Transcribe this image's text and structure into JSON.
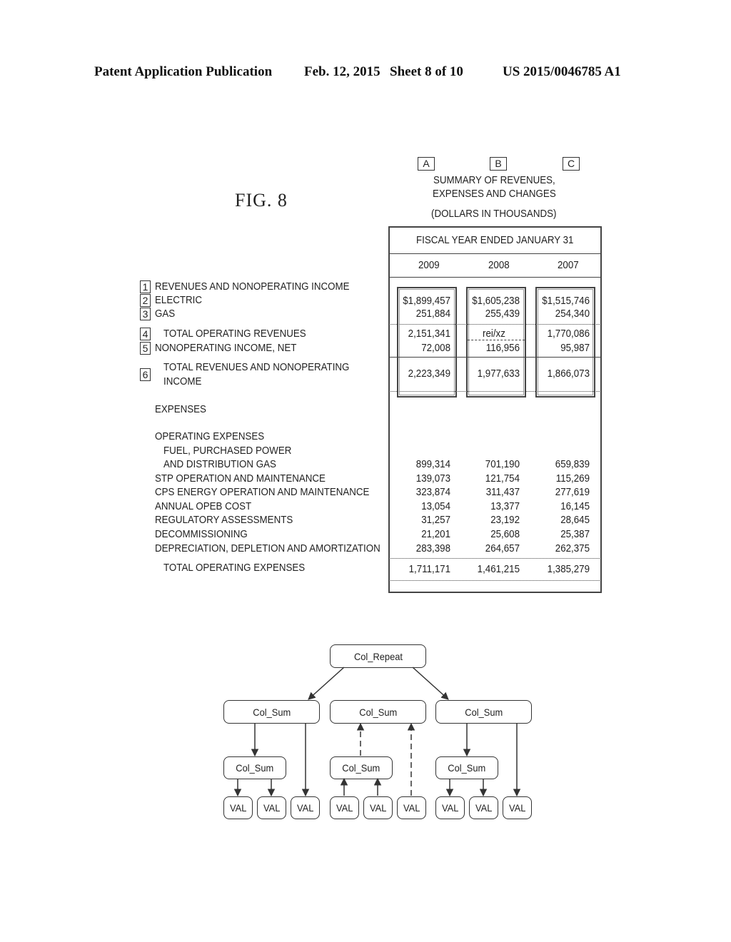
{
  "header": {
    "publication": "Patent Application Publication",
    "date": "Feb. 12, 2015",
    "sheet": "Sheet 8 of 10",
    "patent_number": "US 2015/0046785 A1"
  },
  "figure_label": "FIG. 8",
  "column_markers": [
    "A",
    "B",
    "C"
  ],
  "table": {
    "title_line1": "SUMMARY OF REVENUES,",
    "title_line2": "EXPENSES AND CHANGES",
    "units": "(DOLLARS IN THOUSANDS)",
    "period_header": "FISCAL YEAR ENDED JANUARY 31",
    "years": [
      "2009",
      "2008",
      "2007"
    ],
    "revenue_rows": [
      {
        "marker": "1",
        "label": "REVENUES AND NONOPERATING INCOME",
        "values": [
          "",
          "",
          ""
        ]
      },
      {
        "marker": "2",
        "label": "ELECTRIC",
        "values": [
          "$1,899,457",
          "$1,605,238",
          "$1,515,746"
        ]
      },
      {
        "marker": "3",
        "label": "GAS",
        "values": [
          "251,884",
          "255,439",
          "254,340"
        ]
      },
      {
        "marker": "4",
        "label": "TOTAL OPERATING REVENUES",
        "values": [
          "2,151,341",
          "rei/xz",
          "1,770,086"
        ]
      },
      {
        "marker": "5",
        "label": "NONOPERATING INCOME, NET",
        "values": [
          "72,008",
          "116,956",
          "95,987"
        ]
      },
      {
        "marker": "6",
        "label_line1": "TOTAL REVENUES AND NONOPERATING",
        "label_line2": "INCOME",
        "values": [
          "2,223,349",
          "1,977,633",
          "1,866,073"
        ]
      }
    ],
    "expenses_heading": "EXPENSES",
    "operating_expenses_heading": "OPERATING EXPENSES",
    "expense_rows": [
      {
        "label_line1": "FUEL, PURCHASED POWER",
        "label_line2": "AND DISTRIBUTION GAS",
        "values": [
          "899,314",
          "701,190",
          "659,839"
        ]
      },
      {
        "label": "STP OPERATION AND MAINTENANCE",
        "values": [
          "139,073",
          "121,754",
          "115,269"
        ]
      },
      {
        "label": "CPS ENERGY OPERATION AND MAINTENANCE",
        "values": [
          "323,874",
          "311,437",
          "277,619"
        ]
      },
      {
        "label": "ANNUAL OPEB COST",
        "values": [
          "13,054",
          "13,377",
          "16,145"
        ]
      },
      {
        "label": "REGULATORY ASSESSMENTS",
        "values": [
          "31,257",
          "23,192",
          "28,645"
        ]
      },
      {
        "label": "DECOMMISSIONING",
        "values": [
          "21,201",
          "25,608",
          "25,387"
        ]
      },
      {
        "label": "DEPRECIATION, DEPLETION AND AMORTIZATION",
        "values": [
          "283,398",
          "264,657",
          "262,375"
        ]
      }
    ],
    "total_expenses": {
      "label": "TOTAL OPERATING EXPENSES",
      "values": [
        "1,711,171",
        "1,461,215",
        "1,385,279"
      ]
    }
  },
  "tree": {
    "root": "Col_Repeat",
    "level1": [
      "Col_Sum",
      "Col_Sum",
      "Col_Sum"
    ],
    "level2": [
      "Col_Sum",
      "Col_Sum",
      "Col_Sum"
    ],
    "leaves": [
      "VAL",
      "VAL",
      "VAL",
      "VAL",
      "VAL",
      "VAL",
      "VAL",
      "VAL",
      "VAL"
    ]
  }
}
